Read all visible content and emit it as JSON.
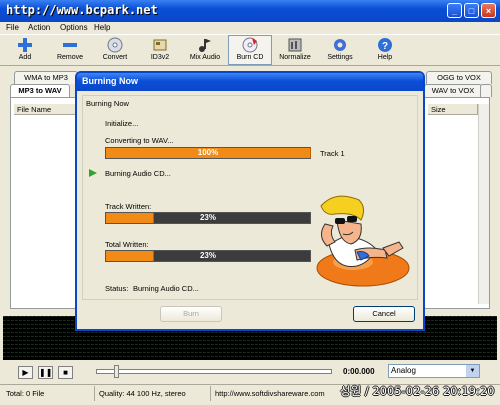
{
  "window": {
    "title": "http://www.bcpark.net"
  },
  "menu": [
    "File",
    "Action",
    "Options",
    "Help"
  ],
  "toolbar": [
    {
      "label": "Add",
      "icon": "add-icon"
    },
    {
      "label": "Remove",
      "icon": "remove-icon"
    },
    {
      "label": "Convert",
      "icon": "convert-icon"
    },
    {
      "label": "ID3v2",
      "icon": "id3v2-icon"
    },
    {
      "label": "Mix Audio",
      "icon": "mix-audio-icon"
    },
    {
      "label": "Burn CD",
      "icon": "burn-cd-icon"
    },
    {
      "label": "Normalize",
      "icon": "normalize-icon"
    },
    {
      "label": "Settings",
      "icon": "settings-icon"
    },
    {
      "label": "Help",
      "icon": "help-icon"
    }
  ],
  "tabs": {
    "row1": [
      "WMA to MP3",
      "OGG to VOX"
    ],
    "row2": [
      "MP3 to WAV",
      "WAV to VOX"
    ]
  },
  "list": {
    "columns": [
      "File Name",
      "Size"
    ]
  },
  "transport": {
    "time": "0:00.000",
    "mode": "Analog"
  },
  "status": {
    "total": "Total: 0 File",
    "quality": "Quality: 44 100 Hz, stereo",
    "url": "http://www.softdivshareware.com"
  },
  "watermark": "성원 / 2005-02-26 20:19:20",
  "dialog": {
    "title": "Burning Now",
    "group_label": "Burning Now",
    "initialize": "Initialize...",
    "converting": "Converting to WAV...",
    "converting_progress": 1.0,
    "converting_pct": "100%",
    "track_label": "Track 1",
    "burning": "Burning Audio CD...",
    "track_written_label": "Track Written:",
    "track_written_progress": 0.23,
    "track_written_pct": "23%",
    "total_written_label": "Total Written:",
    "total_written_progress": 0.23,
    "total_written_pct": "23%",
    "status_label": "Status:",
    "status_value": "Burning Audio CD...",
    "burn_button": "Burn",
    "cancel_button": "Cancel"
  },
  "colors": {
    "titlebar": "#0a4fd6",
    "progress_fill": "#f28a16",
    "progress_track": "#3c3c3c"
  }
}
